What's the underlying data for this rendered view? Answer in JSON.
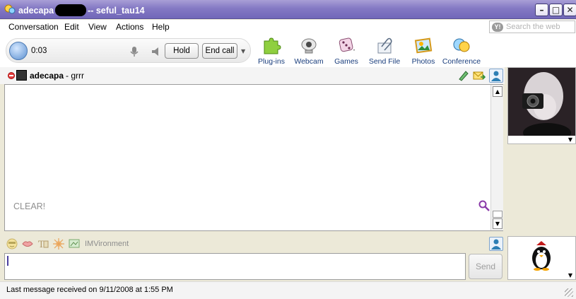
{
  "window": {
    "title_prefix": "adecapa",
    "title_suffix": "-- seful_tau14",
    "minimize_glyph": "–",
    "maximize_glyph": "□",
    "close_glyph": "✕"
  },
  "menu": {
    "items": [
      "Conversation",
      "Edit",
      "View",
      "Actions",
      "Help"
    ],
    "search_placeholder": "Search the web",
    "search_badge": "Y!"
  },
  "call": {
    "timer": "0:03",
    "hold_label": "Hold",
    "end_label": "End call",
    "dropdown_glyph": "▼"
  },
  "toolbar": {
    "tools": [
      {
        "label": "Plug-ins",
        "icon": "puzzle-piece-icon"
      },
      {
        "label": "Webcam",
        "icon": "webcam-icon"
      },
      {
        "label": "Games",
        "icon": "dice-icon"
      },
      {
        "label": "Send File",
        "icon": "paperclip-icon"
      },
      {
        "label": "Photos",
        "icon": "photo-icon"
      },
      {
        "label": "Conference",
        "icon": "conference-icon"
      }
    ]
  },
  "contact": {
    "name": "adecapa",
    "status": "- grrr"
  },
  "conversation": {
    "text": "CLEAR!",
    "scroll_up": "▲",
    "scroll_down": "▼"
  },
  "compose": {
    "imvironment_label": "IMVironment",
    "send_label": "Send"
  },
  "status_bar": {
    "text": "Last message received on 9/11/2008 at 1:55 PM"
  },
  "avatars": {
    "dropdown_glyph": "▼"
  },
  "colors": {
    "titlebar": "#8479c4",
    "link_blue": "#1a3e7d"
  }
}
